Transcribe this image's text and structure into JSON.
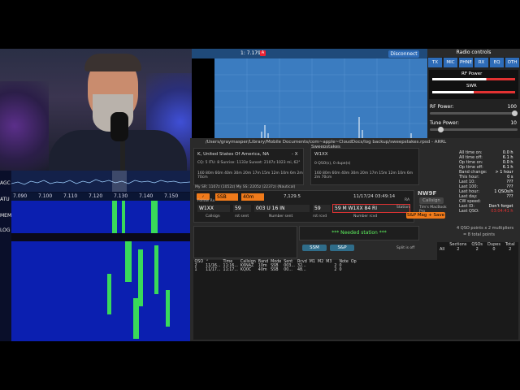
{
  "scope": {
    "vfo_label": "1: 7.179",
    "vfo_badge": "A",
    "disconnect": "Disconnect"
  },
  "radio_controls": {
    "title": "Radio controls",
    "tabs": [
      "TX",
      "MIC",
      "PHNE",
      "RX",
      "EQ",
      "OTH"
    ],
    "meter_rf_label": "RF Power",
    "meter_swr_label": "SWR",
    "rf_power_label": "RF Power:",
    "rf_power_value": "100",
    "tune_power_label": "Tune Power:",
    "tune_power_value": "10",
    "rf_power_level": 1.0,
    "tune_power_level": 0.1
  },
  "sdr": {
    "freq_ticks": [
      "7.090",
      "7.100",
      "7.110",
      "7.120",
      "7.130",
      "7.140",
      "7.150"
    ],
    "side_labels": [
      "AGC",
      "ATU",
      "MEM",
      "LOG"
    ]
  },
  "n1mm": {
    "path": "/Users/graymasper/Library/Mobile Documents/com~apple~CloudDocs/log backup/sweepstakes.rpsd - ARRL Sweepstakes",
    "dx_title": "K, United States Of America, NA",
    "dx_close": "- X",
    "dx_info": "CQ: 5 ITU: 8 Sunrise: 1133z Sunset: 2107z 1023 mi, 62°",
    "band_scale": "160 80m 60m 40m 30m 20m 17m 15m 12m 10m 6m 2m 70cm",
    "call_title": "W1XX",
    "call_info": "0 QSO(s), 0 dupe(s)",
    "band_scale2": "160 80m 60m 40m 30m 20m 17m 15m 12m 10m 6m 2m 70cm",
    "subtitle": "My SR: 1107z (1052z) My SS: 2205z (2237z) (Nautical)",
    "follow_rx": "Follow Rx",
    "mode": "SSB",
    "band": "40m",
    "freq": "7,129.5",
    "datetime": "11/17/24  03:49:14",
    "entry": {
      "callsign": "W1XX",
      "rst_sent": "59",
      "number_sent": "003 U 16 IN",
      "rst_rcvd": "59",
      "number_rcvd": "59 M W1XX 84 RI",
      "callsign_lbl": "Callsign",
      "rst_sent_lbl": "rst sent",
      "number_sent_lbl": "Number sent",
      "rst_rcvd_lbl": "rst rcvd",
      "number_rcvd_lbl": "Number rcvd"
    },
    "station_call": "NW9F",
    "station_ra": "RA",
    "callsign_btn": "Callsign",
    "station_lbl": "Station:",
    "station_val": "Tim's MacBook Pro",
    "snp_btn": "S&P Mag + Save",
    "needed": "*** Needed station ***",
    "ssm_btn": "SSM",
    "snp_small": "S&P",
    "split": "Split is off",
    "log_headers": [
      "QSO",
      "⌃",
      "Time",
      "Callsign",
      "Band",
      "Mode",
      "Sent",
      "Rcvd",
      "M1",
      "M2",
      "M3",
      "",
      "Note",
      "Op"
    ],
    "log_rows": [
      [
        "2",
        "11/16...",
        "11:16...",
        "K6NAZ",
        "10m",
        "SSB",
        "003...",
        "32...",
        "",
        "",
        "",
        "2",
        "0",
        ""
      ],
      [
        "1",
        "11/17...",
        "11:17...",
        "KQ0C",
        "40m",
        "SSB",
        "00...",
        "48...",
        "",
        "",
        "",
        "2",
        "0",
        ""
      ]
    ],
    "stats": [
      [
        "All time on:",
        "0.0 h"
      ],
      [
        "All time off:",
        "6.1 h"
      ],
      [
        "Op time on:",
        "0.0 h"
      ],
      [
        "Op time off:",
        "6.1 h"
      ],
      [
        "Band change:",
        "> 1 hour"
      ],
      [
        "This hour:",
        "0 s"
      ],
      [
        "Last 10:",
        "???"
      ],
      [
        "Last 100:",
        "???"
      ],
      [
        "Last hour:",
        "1 QSOs/h"
      ],
      [
        "Last day:",
        "???"
      ],
      [
        "CW speed:",
        ""
      ],
      [
        "Last ID:",
        "Don't forget"
      ],
      [
        "Last QSO:",
        "03:04:41 h"
      ]
    ],
    "points": "4 QSO points x 2 multipliers",
    "total": "= 8 total points",
    "mult_headers": [
      "",
      "Sections",
      "QSOs",
      "Dupes",
      "Total"
    ],
    "mult_rows": [
      [
        "All",
        "2",
        "2",
        "0",
        "2"
      ]
    ]
  },
  "colors": {
    "accent": "#2e6cb8",
    "orange": "#f07a1a",
    "green": "#5df05d",
    "alert": "#e23232"
  }
}
